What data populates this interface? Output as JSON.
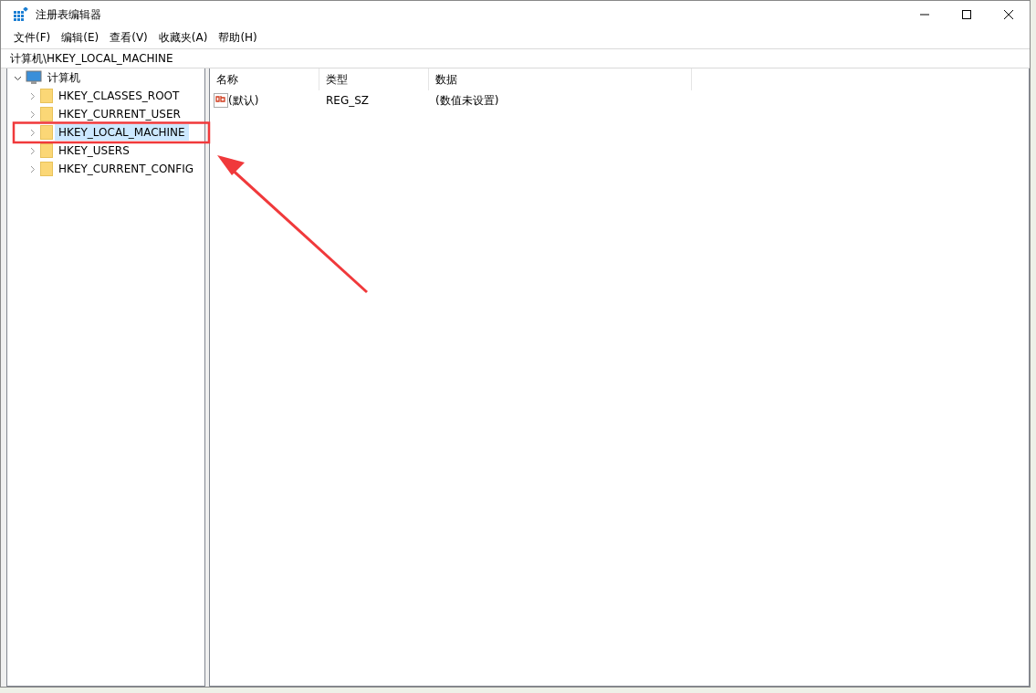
{
  "window": {
    "title": "注册表编辑器"
  },
  "menu": [
    "文件(F)",
    "编辑(E)",
    "查看(V)",
    "收藏夹(A)",
    "帮助(H)"
  ],
  "address": {
    "value": "计算机\\HKEY_LOCAL_MACHINE"
  },
  "tree": [
    {
      "label": "计算机",
      "kind": "computer",
      "expanded": true,
      "selected": false,
      "children": [
        {
          "label": "HKEY_CLASSES_ROOT",
          "kind": "folder",
          "expanded": false,
          "selected": false
        },
        {
          "label": "HKEY_CURRENT_USER",
          "kind": "folder",
          "expanded": false,
          "selected": false
        },
        {
          "label": "HKEY_LOCAL_MACHINE",
          "kind": "folder",
          "expanded": false,
          "selected": true
        },
        {
          "label": "HKEY_USERS",
          "kind": "folder",
          "expanded": false,
          "selected": false
        },
        {
          "label": "HKEY_CURRENT_CONFIG",
          "kind": "folder",
          "expanded": false,
          "selected": false
        }
      ]
    }
  ],
  "table": {
    "columns": [
      "名称",
      "类型",
      "数据"
    ],
    "rows": [
      {
        "name": "(默认)",
        "type": "REG_SZ",
        "data": "(数值未设置)"
      }
    ]
  }
}
